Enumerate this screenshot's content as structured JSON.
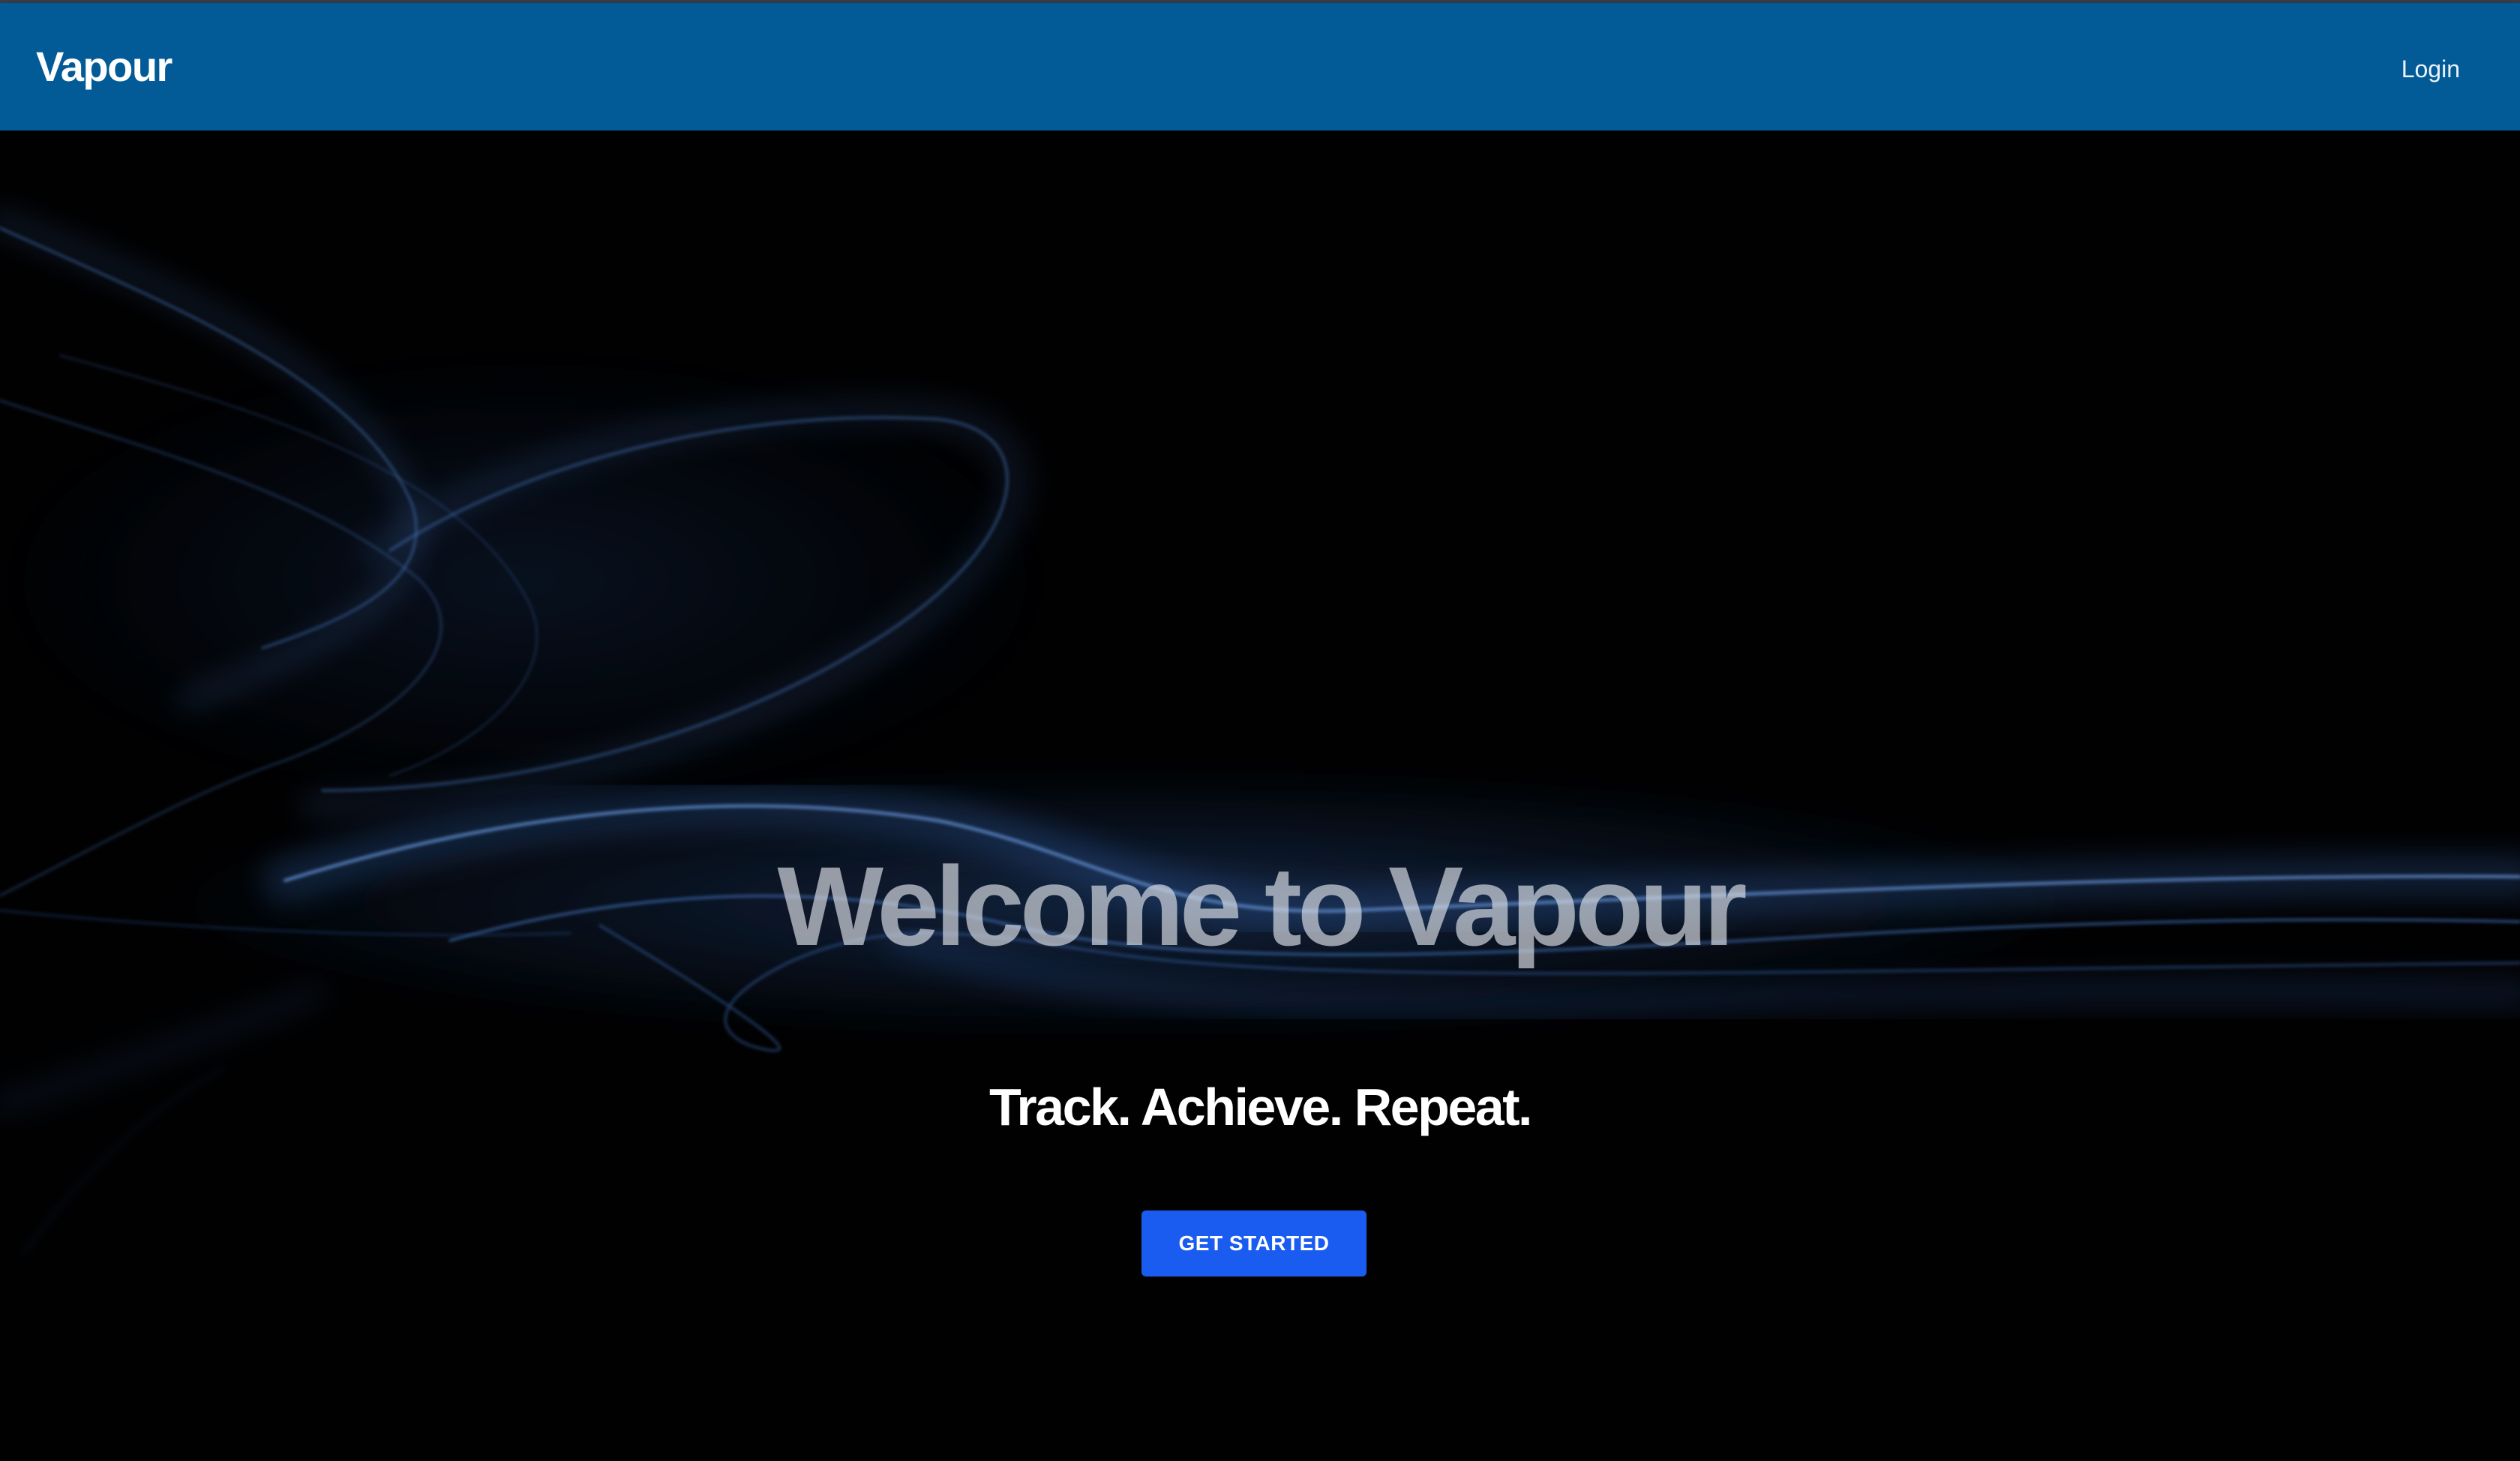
{
  "navbar": {
    "brand": "Vapour",
    "login_label": "Login",
    "background_color": "#025b97"
  },
  "hero": {
    "headline": "Welcome to Vapour",
    "tagline": "Track. Achieve. Repeat.",
    "cta_label": "GET STARTED",
    "cta_color": "#1a5cf0",
    "background_image": "blue-smoke-on-black"
  }
}
